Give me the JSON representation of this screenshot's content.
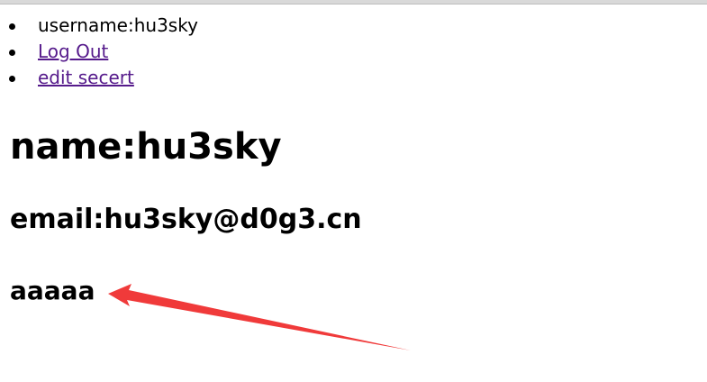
{
  "nav": {
    "items": [
      {
        "label": "username:hu3sky",
        "type": "text"
      },
      {
        "label": "Log Out",
        "type": "link"
      },
      {
        "label": "edit secert",
        "type": "link"
      }
    ]
  },
  "profile": {
    "name_heading": "name:hu3sky",
    "email_heading": "email:hu3sky@d0g3.cn",
    "secret_heading": "aaaaa"
  },
  "annotation": {
    "arrow_color": "#f03a3a",
    "icon": "annotation-arrow-icon"
  },
  "colors": {
    "link": "#551a8b",
    "text": "#000000"
  }
}
